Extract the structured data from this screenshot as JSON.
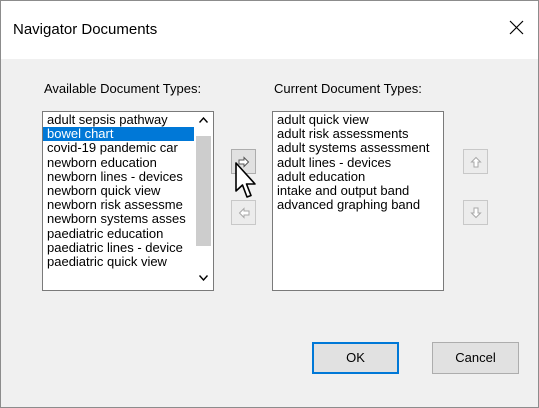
{
  "window": {
    "title": "Navigator Documents",
    "close_icon": "close-icon"
  },
  "available": {
    "label": "Available Document Types:",
    "selected_index": 1,
    "items": [
      "adult sepsis pathway",
      "bowel chart",
      "covid-19 pandemic car",
      "newborn education",
      "newborn lines - devices",
      "newborn quick view",
      "newborn risk assessme",
      "newborn systems asses",
      "paediatric education",
      "paediatric lines - device",
      "paediatric quick view"
    ]
  },
  "current": {
    "label": "Current Document Types:",
    "items": [
      "adult quick view",
      "adult risk assessments",
      "adult systems assessment",
      "adult lines - devices",
      "adult education",
      "intake and output band",
      "advanced graphing band"
    ]
  },
  "transfer_buttons": {
    "add_icon": "arrow-right-icon",
    "remove_icon": "arrow-left-icon",
    "move_up_icon": "arrow-up-icon",
    "move_down_icon": "arrow-down-icon"
  },
  "buttons": {
    "ok": "OK",
    "cancel": "Cancel"
  },
  "colors": {
    "selection": "#0078d7",
    "face": "#f0f0f0",
    "button": "#e1e1e1"
  }
}
